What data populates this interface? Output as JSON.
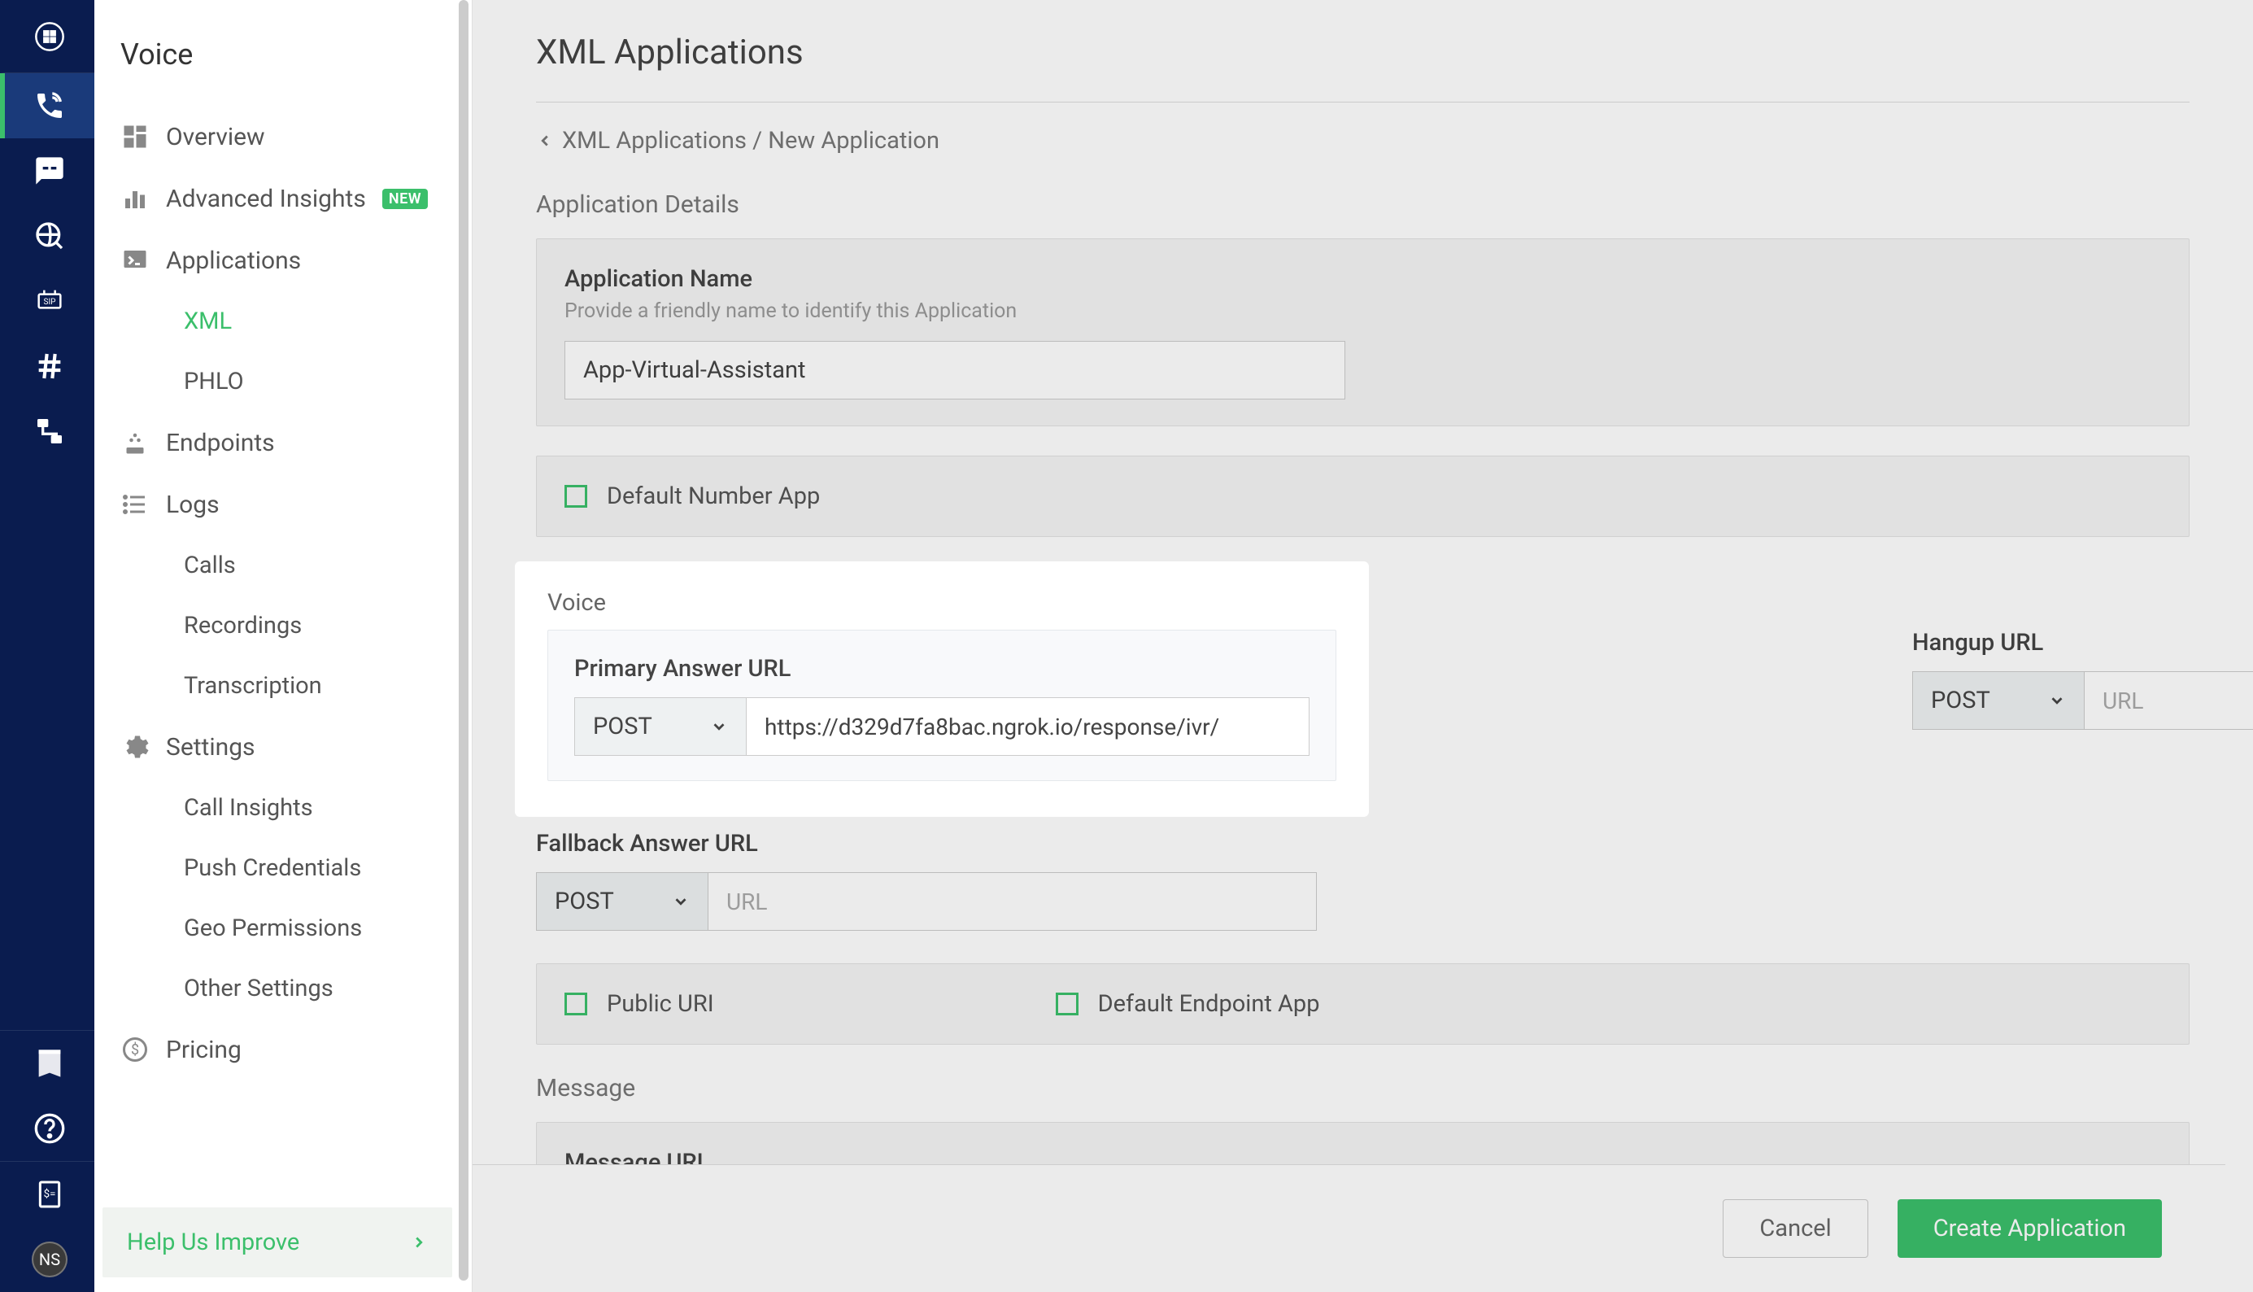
{
  "rail": {
    "avatar_initials": "NS"
  },
  "sidebar": {
    "title": "Voice",
    "items": {
      "overview": {
        "label": "Overview"
      },
      "insights": {
        "label": "Advanced Insights",
        "badge": "NEW"
      },
      "applications": {
        "label": "Applications"
      },
      "xml": {
        "label": "XML"
      },
      "phlo": {
        "label": "PHLO"
      },
      "endpoints": {
        "label": "Endpoints"
      },
      "logs": {
        "label": "Logs"
      },
      "calls": {
        "label": "Calls"
      },
      "recordings": {
        "label": "Recordings"
      },
      "transcription": {
        "label": "Transcription"
      },
      "settings": {
        "label": "Settings"
      },
      "call_insights": {
        "label": "Call Insights"
      },
      "push_credentials": {
        "label": "Push Credentials"
      },
      "geo_permissions": {
        "label": "Geo Permissions"
      },
      "other_settings": {
        "label": "Other Settings"
      },
      "pricing": {
        "label": "Pricing"
      }
    },
    "help_improve": "Help Us Improve"
  },
  "main": {
    "page_title": "XML Applications",
    "breadcrumb": "XML Applications / New Application",
    "sections": {
      "details_header": "Application Details",
      "app_name_label": "Application Name",
      "app_name_hint": "Provide a friendly name to identify this Application",
      "app_name_value": "App-Virtual-Assistant",
      "default_number": "Default Number App",
      "voice_header": "Voice",
      "primary_label": "Primary Answer URL",
      "primary_method": "POST",
      "primary_url": "https://d329d7fa8bac.ngrok.io/response/ivr/",
      "hangup_label": "Hangup URL",
      "hangup_method": "POST",
      "hangup_placeholder": "URL",
      "fallback_label": "Fallback Answer URL",
      "fallback_method": "POST",
      "fallback_placeholder": "URL",
      "public_uri": "Public URI",
      "default_endpoint": "Default Endpoint App",
      "message_header": "Message",
      "message_url_label": "Message URL"
    },
    "footer": {
      "cancel": "Cancel",
      "create": "Create Application"
    }
  }
}
